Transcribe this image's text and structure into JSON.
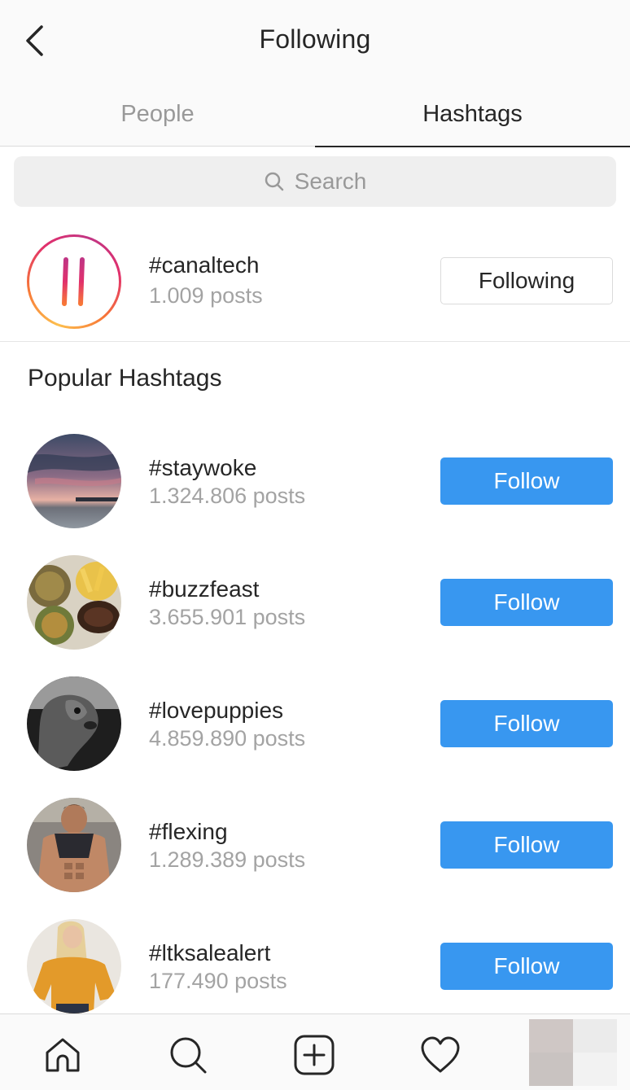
{
  "header": {
    "title": "Following",
    "back_icon": "chevron-left-icon"
  },
  "tabs": [
    {
      "label": "People",
      "active": false
    },
    {
      "label": "Hashtags",
      "active": true
    }
  ],
  "search": {
    "placeholder": "Search",
    "icon": "search-icon"
  },
  "followed_hashtag": {
    "name": "#canaltech",
    "posts": "1.009 posts",
    "button_label": "Following"
  },
  "popular": {
    "title": "Popular Hashtags",
    "items": [
      {
        "name": "#staywoke",
        "posts": "1.324.806 posts",
        "button_label": "Follow"
      },
      {
        "name": "#buzzfeast",
        "posts": "3.655.901 posts",
        "button_label": "Follow"
      },
      {
        "name": "#lovepuppies",
        "posts": "4.859.890 posts",
        "button_label": "Follow"
      },
      {
        "name": "#flexing",
        "posts": "1.289.389 posts",
        "button_label": "Follow"
      },
      {
        "name": "#ltksalealert",
        "posts": "177.490 posts",
        "button_label": "Follow"
      }
    ]
  },
  "bottom_nav": [
    "home-icon",
    "search-icon",
    "add-post-icon",
    "heart-icon",
    "profile-avatar"
  ],
  "colors": {
    "follow_blue": "#3897f0",
    "text_primary": "#262626",
    "text_secondary": "#a3a3a3"
  }
}
